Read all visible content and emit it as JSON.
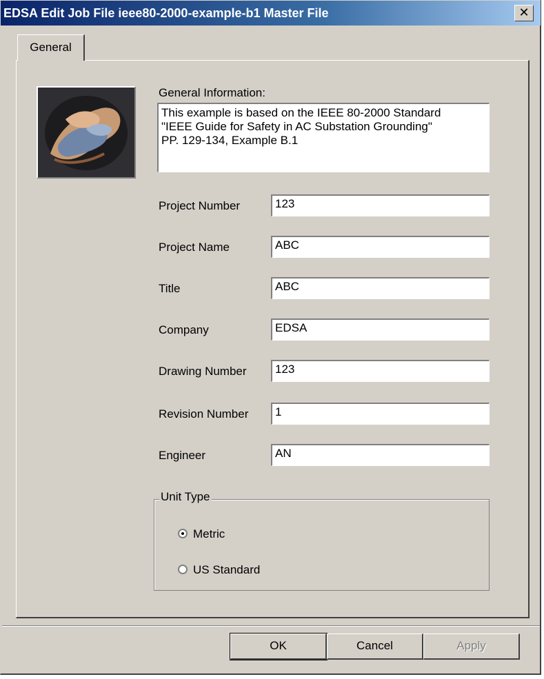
{
  "window": {
    "title": "EDSA Edit Job File  ieee80-2000-example-b1  Master File",
    "close_glyph": "✕"
  },
  "tabs": [
    {
      "label": "General"
    }
  ],
  "general": {
    "info_label": "General Information:",
    "info_text": "This example is based on the IEEE 80-2000 Standard\n\"IEEE Guide for Safety in AC Substation Grounding\"\nPP. 129-134, Example B.1",
    "fields": [
      {
        "label": "Project Number",
        "value": "123"
      },
      {
        "label": "Project Name",
        "value": "ABC"
      },
      {
        "label": "Title",
        "value": "ABC"
      },
      {
        "label": "Company",
        "value": "EDSA"
      },
      {
        "label": "Drawing Number",
        "value": "123"
      },
      {
        "label": "Revision Number",
        "value": "1"
      },
      {
        "label": "Engineer",
        "value": "AN"
      }
    ]
  },
  "unit_type": {
    "label": "Unit Type",
    "options": [
      {
        "label": "Metric",
        "selected": true
      },
      {
        "label": "US Standard",
        "selected": false
      }
    ]
  },
  "buttons": {
    "ok": "OK",
    "cancel": "Cancel",
    "apply": "Apply"
  },
  "colors": {
    "titlebar_start": "#0a246a",
    "titlebar_end": "#a6caf0",
    "face": "#d4d0c8"
  }
}
